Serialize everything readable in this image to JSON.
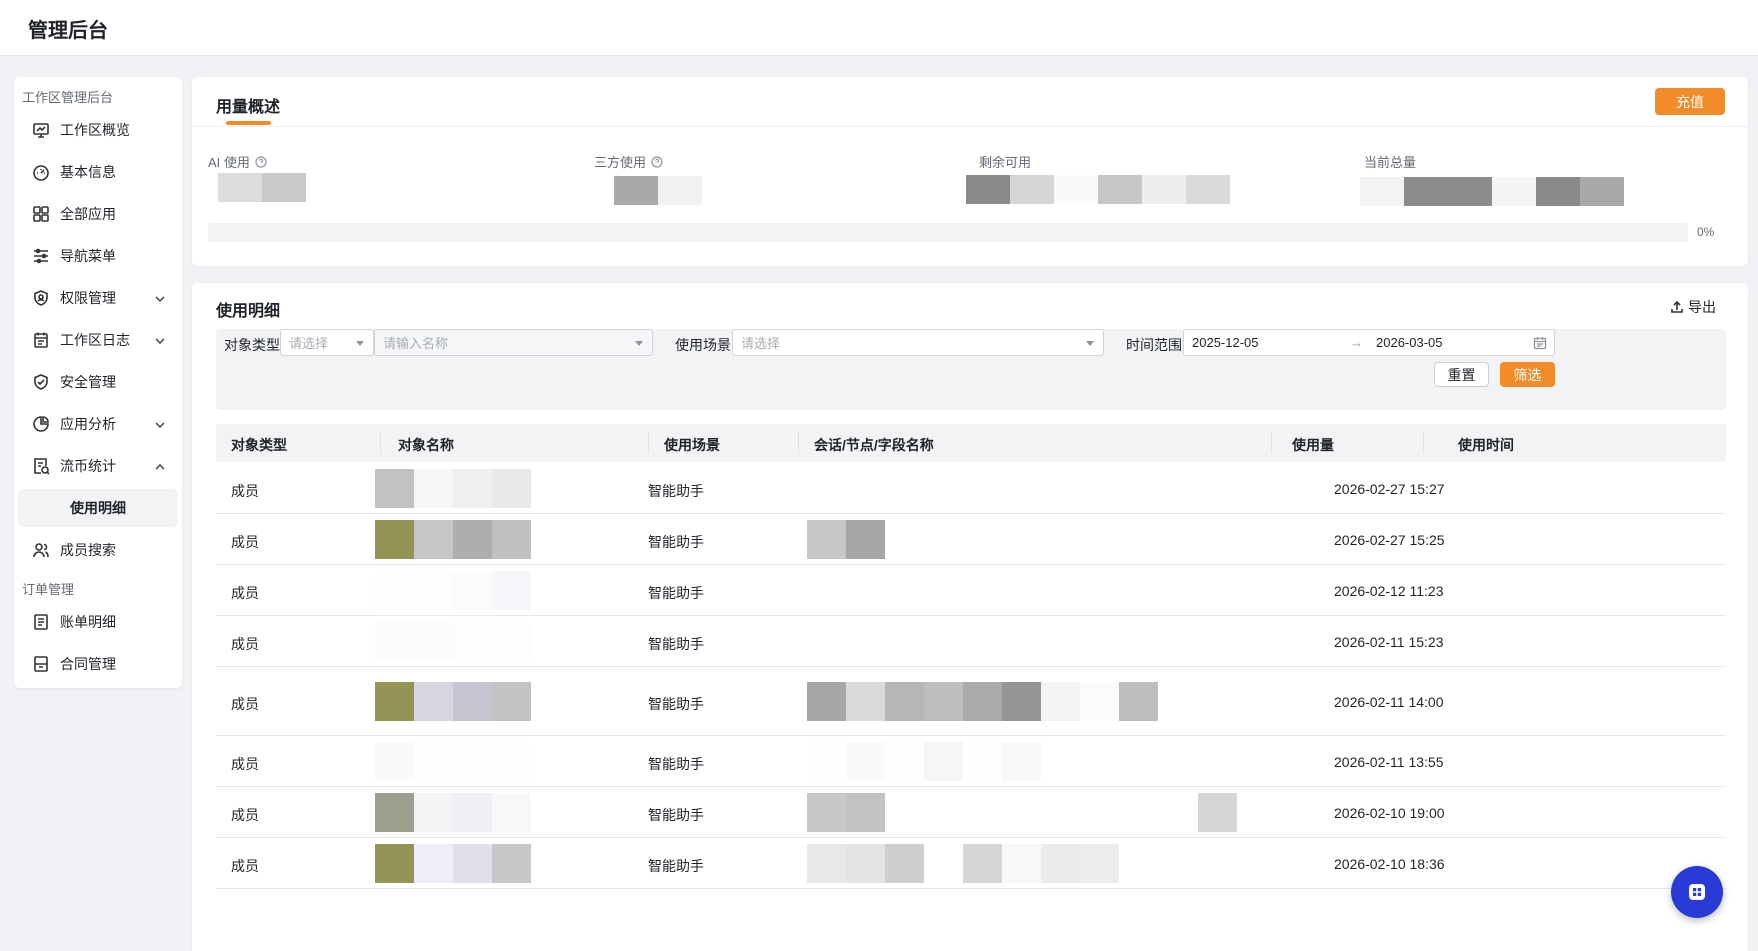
{
  "app": {
    "title": "管理后台"
  },
  "sidebar": {
    "group1": "工作区管理后台",
    "group2": "订单管理",
    "items": [
      {
        "label": "工作区概览",
        "icon": "monitor-icon"
      },
      {
        "label": "基本信息",
        "icon": "dashboard-icon"
      },
      {
        "label": "全部应用",
        "icon": "grid-icon"
      },
      {
        "label": "导航菜单",
        "icon": "sliders-icon"
      },
      {
        "label": "权限管理",
        "icon": "shield-user-icon",
        "expandable": true
      },
      {
        "label": "工作区日志",
        "icon": "calendar-icon",
        "expandable": true
      },
      {
        "label": "安全管理",
        "icon": "shield-check-icon"
      },
      {
        "label": "应用分析",
        "icon": "pie-chart-icon",
        "expandable": true
      },
      {
        "label": "流币统计",
        "icon": "stats-doc-icon",
        "expandable": true,
        "expanded": true
      },
      {
        "label": "使用明细",
        "sub": true,
        "active": true
      },
      {
        "label": "成员搜索",
        "icon": "users-icon"
      },
      {
        "label": "账单明细",
        "icon": "bill-icon"
      },
      {
        "label": "合同管理",
        "icon": "contract-icon"
      }
    ]
  },
  "overview": {
    "title": "用量概述",
    "recharge": "充值",
    "stats": [
      {
        "label": "AI 使用",
        "help": true
      },
      {
        "label": "三方使用",
        "help": true
      },
      {
        "label": "剩余可用",
        "help": false
      },
      {
        "label": "当前总量",
        "help": false
      }
    ],
    "progress_percent": 0,
    "progress_label": "0%"
  },
  "detail": {
    "title": "使用明细",
    "export": "导出",
    "filters": {
      "type_label": "对象类型",
      "type_placeholder": "请选择",
      "name_placeholder": "请输入名称",
      "scene_label": "使用场景",
      "scene_placeholder": "请选择",
      "time_label": "时间范围",
      "start": "2025-12-05",
      "arrow": "→",
      "end": "2026-03-05",
      "reset": "重置",
      "filter": "筛选"
    },
    "columns": [
      "对象类型",
      "对象名称",
      "使用场景",
      "会话/节点/字段名称",
      "使用量",
      "使用时间"
    ],
    "rows": [
      {
        "type": "成员",
        "scene": "智能助手",
        "time": "2026-02-27 15:27"
      },
      {
        "type": "成员",
        "scene": "智能助手",
        "time": "2026-02-27 15:25"
      },
      {
        "type": "成员",
        "scene": "智能助手",
        "time": "2026-02-12 11:23"
      },
      {
        "type": "成员",
        "scene": "智能助手",
        "time": "2026-02-11 15:23"
      },
      {
        "type": "成员",
        "scene": "智能助手",
        "time": "2026-02-11 14:00"
      },
      {
        "type": "成员",
        "scene": "智能助手",
        "time": "2026-02-11 13:55"
      },
      {
        "type": "成员",
        "scene": "智能助手",
        "time": "2026-02-10 19:00"
      },
      {
        "type": "成员",
        "scene": "智能助手",
        "time": "2026-02-10 18:36"
      }
    ]
  },
  "colors": {
    "accent": "#f28c28",
    "fab": "#2a3ad6"
  }
}
